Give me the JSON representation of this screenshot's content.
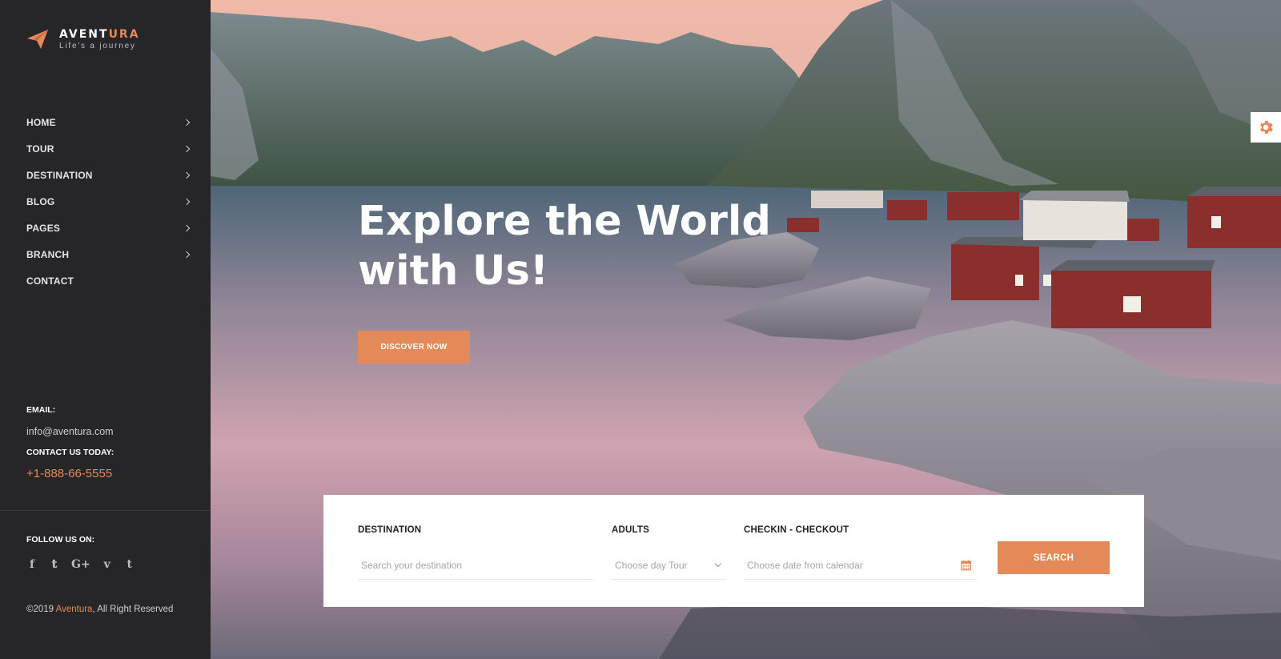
{
  "brand": {
    "name_main": "AVENT",
    "name_accent": "URA",
    "tagline": "Life's a journey"
  },
  "nav": [
    {
      "label": "HOME",
      "has_submenu": true
    },
    {
      "label": "TOUR",
      "has_submenu": true
    },
    {
      "label": "DESTINATION",
      "has_submenu": true
    },
    {
      "label": "BLOG",
      "has_submenu": true
    },
    {
      "label": "PAGES",
      "has_submenu": true
    },
    {
      "label": "BRANCH",
      "has_submenu": true
    },
    {
      "label": "CONTACT",
      "has_submenu": false
    }
  ],
  "contact": {
    "email_label": "EMAIL:",
    "email": "info@aventura.com",
    "phone_label": "CONTACT US TODAY:",
    "phone": "+1-888-66-5555"
  },
  "follow": {
    "label": "FOLLOW US ON:",
    "icons": [
      {
        "name": "facebook-icon",
        "glyph": "f"
      },
      {
        "name": "twitter-icon",
        "glyph": "𝕥"
      },
      {
        "name": "google-plus-icon",
        "glyph": "G+"
      },
      {
        "name": "vimeo-icon",
        "glyph": "v"
      },
      {
        "name": "tumblr-icon",
        "glyph": "t"
      }
    ]
  },
  "footer": {
    "prefix": "©2019 ",
    "brand": "Aventura",
    "suffix": ", All Right Reserved"
  },
  "hero": {
    "title_line1": "Explore the World",
    "title_line2": "with Us!",
    "cta_label": "DISCOVER NOW"
  },
  "search": {
    "destination_label": "DESTINATION",
    "destination_placeholder": "Search your destination",
    "adults_label": "ADULTS",
    "adults_value": "Choose day Tour",
    "dates_label": "CHECKIN - CHECKOUT",
    "dates_placeholder": "Choose date from calendar",
    "button_label": "SEARCH"
  },
  "colors": {
    "accent": "#e48a59",
    "sidebar_bg": "#262628"
  }
}
